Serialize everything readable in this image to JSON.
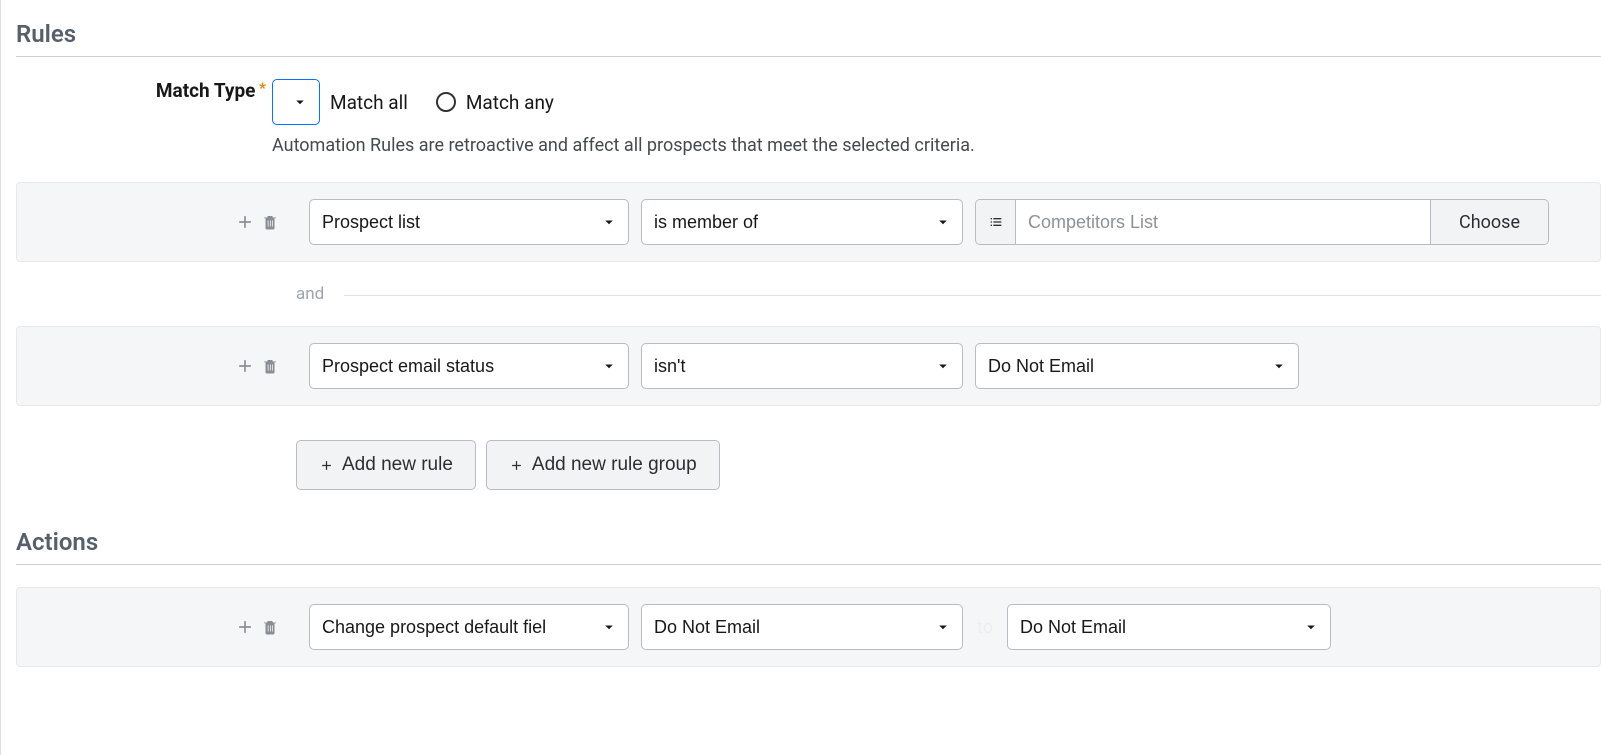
{
  "sections": {
    "rules": "Rules",
    "actions": "Actions"
  },
  "matchType": {
    "label": "Match Type",
    "options": {
      "all": "Match all",
      "any": "Match any"
    },
    "selected": "all",
    "help": "Automation Rules are retroactive and affect all prospects that meet the selected criteria."
  },
  "rules": [
    {
      "field": "Prospect list",
      "operator": "is member of",
      "value_kind": "lookup",
      "value_text": "Competitors List",
      "choose_label": "Choose"
    },
    {
      "field": "Prospect email status",
      "operator": "isn't",
      "value_kind": "select",
      "value_text": "Do Not Email"
    }
  ],
  "joiner": "and",
  "buttons": {
    "add_rule": "Add new rule",
    "add_group": "Add new rule group"
  },
  "actions": [
    {
      "action": "Change prospect default fiel",
      "target_field": "Do Not Email",
      "to_label": "to",
      "target_value": "Do Not Email"
    }
  ]
}
